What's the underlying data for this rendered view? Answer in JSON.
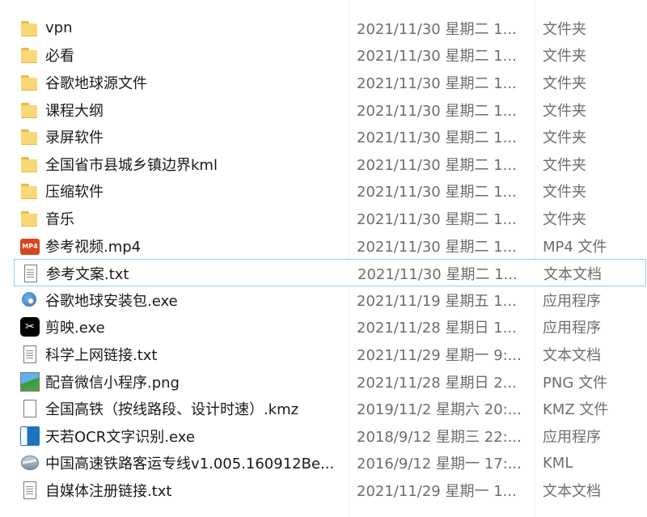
{
  "files": [
    {
      "name": "vpn",
      "date": "2021/11/30 星期二 1...",
      "type": "文件夹",
      "icon": "folder-icon",
      "kind": "folder",
      "selected": false
    },
    {
      "name": "必看",
      "date": "2021/11/30 星期二 1...",
      "type": "文件夹",
      "icon": "folder-icon",
      "kind": "folder",
      "selected": false
    },
    {
      "name": "谷歌地球源文件",
      "date": "2021/11/30 星期二 1...",
      "type": "文件夹",
      "icon": "folder-icon",
      "kind": "folder",
      "selected": false
    },
    {
      "name": "课程大纲",
      "date": "2021/11/30 星期二 1...",
      "type": "文件夹",
      "icon": "folder-icon",
      "kind": "folder",
      "selected": false
    },
    {
      "name": "录屏软件",
      "date": "2021/11/30 星期二 1...",
      "type": "文件夹",
      "icon": "folder-icon",
      "kind": "folder",
      "selected": false
    },
    {
      "name": "全国省市县城乡镇边界kml",
      "date": "2021/11/30 星期二 1...",
      "type": "文件夹",
      "icon": "folder-icon",
      "kind": "folder",
      "selected": false
    },
    {
      "name": "压缩软件",
      "date": "2021/11/30 星期二 1...",
      "type": "文件夹",
      "icon": "folder-icon",
      "kind": "folder",
      "selected": false
    },
    {
      "name": "音乐",
      "date": "2021/11/30 星期二 1...",
      "type": "文件夹",
      "icon": "folder-icon",
      "kind": "folder",
      "selected": false
    },
    {
      "name": "参考视频.mp4",
      "date": "2021/11/30 星期二 1...",
      "type": "MP4 文件",
      "icon": "mp4-icon",
      "kind": "mp4",
      "icon_text": "MP4",
      "selected": false
    },
    {
      "name": "参考文案.txt",
      "date": "2021/11/30 星期二 1...",
      "type": "文本文档",
      "icon": "text-document-icon",
      "kind": "doc",
      "selected": true
    },
    {
      "name": "谷歌地球安装包.exe",
      "date": "2021/11/19 星期五 1...",
      "type": "应用程序",
      "icon": "installer-icon",
      "kind": "installer",
      "selected": false
    },
    {
      "name": "剪映.exe",
      "date": "2021/11/28 星期日 1...",
      "type": "应用程序",
      "icon": "capcut-icon",
      "kind": "capcut",
      "icon_text": "✂",
      "selected": false
    },
    {
      "name": "科学上网链接.txt",
      "date": "2021/11/29 星期一 9:...",
      "type": "文本文档",
      "icon": "text-document-icon",
      "kind": "doc",
      "selected": false
    },
    {
      "name": "配音微信小程序.png",
      "date": "2021/11/28 星期日 2...",
      "type": "PNG 文件",
      "icon": "image-icon",
      "kind": "image",
      "selected": false
    },
    {
      "name": "全国高铁（按线路段、设计时速）.kmz",
      "date": "2019/11/2 星期六 20:...",
      "type": "KMZ 文件",
      "icon": "blank-file-icon",
      "kind": "blank",
      "selected": false
    },
    {
      "name": "天若OCR文字识别.exe",
      "date": "2018/9/12 星期三 22:...",
      "type": "应用程序",
      "icon": "ocr-app-icon",
      "kind": "ocr",
      "selected": false
    },
    {
      "name": "中国高速铁路客运专线v1.005.160912Be...",
      "date": "2016/9/12 星期一 17:...",
      "type": "KML",
      "icon": "google-earth-icon",
      "kind": "globe",
      "selected": false
    },
    {
      "name": "自媒体注册链接.txt",
      "date": "2021/11/29 星期一 1...",
      "type": "文本文档",
      "icon": "text-document-icon",
      "kind": "doc",
      "selected": false
    }
  ]
}
